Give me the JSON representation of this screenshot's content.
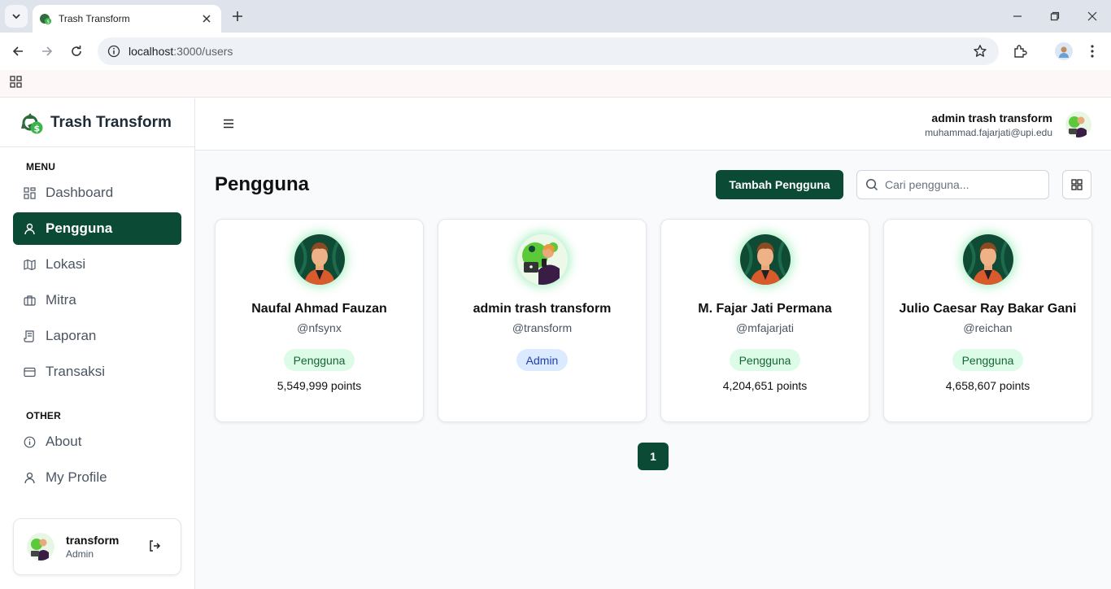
{
  "browser": {
    "tab_title": "Trash Transform",
    "url_host": "localhost",
    "url_path": ":3000/users"
  },
  "sidebar": {
    "brand": "Trash Transform",
    "menu_label": "MENU",
    "items": [
      {
        "label": "Dashboard",
        "icon": "dashboard-icon"
      },
      {
        "label": "Pengguna",
        "icon": "user-icon",
        "active": true
      },
      {
        "label": "Lokasi",
        "icon": "map-icon"
      },
      {
        "label": "Mitra",
        "icon": "building-icon"
      },
      {
        "label": "Laporan",
        "icon": "report-icon"
      },
      {
        "label": "Transaksi",
        "icon": "card-icon"
      }
    ],
    "other_label": "OTHER",
    "other_items": [
      {
        "label": "About",
        "icon": "info-icon"
      },
      {
        "label": "My Profile",
        "icon": "user-icon"
      }
    ],
    "user": {
      "name": "transform",
      "role": "Admin"
    }
  },
  "topbar": {
    "name": "admin trash transform",
    "email": "muhammad.fajarjati@upi.edu"
  },
  "main": {
    "title": "Pengguna",
    "add_button": "Tambah Pengguna",
    "search_placeholder": "Cari pengguna...",
    "cards": [
      {
        "name": "Naufal Ahmad Fauzan",
        "handle": "@nfsynx",
        "role": "Pengguna",
        "points": "5,549,999 points"
      },
      {
        "name": "admin trash transform",
        "handle": "@transform",
        "role": "Admin",
        "points": ""
      },
      {
        "name": "M. Fajar Jati Permana",
        "handle": "@mfajarjati",
        "role": "Pengguna",
        "points": "4,204,651 points"
      },
      {
        "name": "Julio Caesar Ray Bakar Gani",
        "handle": "@reichan",
        "role": "Pengguna",
        "points": "4,658,607 points"
      }
    ],
    "page": "1"
  },
  "colors": {
    "primary": "#0b4a34",
    "user_badge_bg": "#dcfce7",
    "admin_badge_bg": "#dbeafe"
  }
}
